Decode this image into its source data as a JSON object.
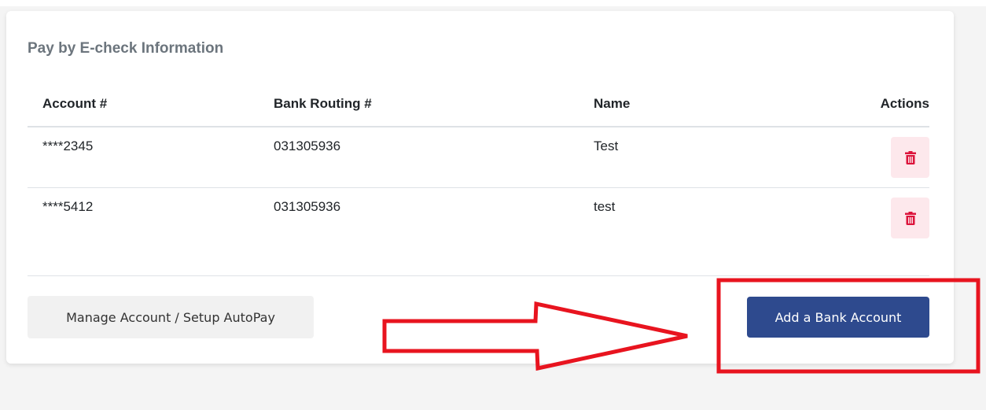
{
  "card": {
    "title": "Pay by E-check Information"
  },
  "table": {
    "headers": {
      "account": "Account #",
      "routing": "Bank Routing #",
      "name": "Name",
      "actions": "Actions"
    },
    "rows": [
      {
        "account": "****2345",
        "routing": "031305936",
        "name": "Test",
        "action_icon": "trash-icon"
      },
      {
        "account": "****5412",
        "routing": "031305936",
        "name": "test",
        "action_icon": "trash-icon"
      }
    ]
  },
  "buttons": {
    "manage_label": "Manage Account / Setup AutoPay",
    "add_label": "Add a Bank Account"
  },
  "annotation": {
    "color": "#e8141f",
    "shapes": [
      "arrow-right",
      "highlight-box"
    ]
  },
  "colors": {
    "primary": "#2e4a8e",
    "danger": "#dc143c",
    "danger_bg": "#fde8ec"
  }
}
